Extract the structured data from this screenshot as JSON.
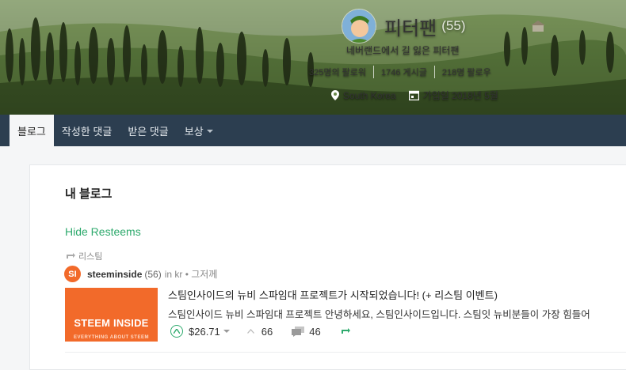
{
  "profile": {
    "name": "피터팬",
    "reputation": "(55)",
    "about": "네버랜드에서 길 잃은 피터팬",
    "followers": "325명의 팔로워",
    "posts": "1746 게시글",
    "following": "218명 팔로우",
    "location": "South Korea",
    "joined": "가입일 2018년 5월"
  },
  "nav": {
    "tabs": [
      "블로그",
      "작성한 댓글",
      "받은 댓글",
      "보상"
    ],
    "active_index": 0
  },
  "blog": {
    "title": "내 블로그",
    "hide_resteems": "Hide Resteems",
    "resteem_label": "리스팀",
    "post": {
      "author_initials": "SI",
      "author": "steeminside",
      "author_rep": "(56)",
      "category": "in kr • 그저께",
      "thumb_text": "STEEM INSIDE",
      "thumb_subtext": "EVERYTHING ABOUT STEEM",
      "title": "스팀인사이드의 뉴비 스파임대 프로젝트가 시작되었습니다! (+ 리스팀 이벤트)",
      "excerpt": "스팀인사이드 뉴비 스파임대 프로젝트 안녕하세요, 스팀인사이드입니다. 스팀잇 뉴비분들이 가장 힘들어",
      "payout": "$26.71",
      "votes": "66",
      "comments": "46"
    }
  },
  "colors": {
    "nav_bg": "#2c3e50",
    "accent_green": "#2eaa6d",
    "steeminside_orange": "#f26a2a"
  }
}
